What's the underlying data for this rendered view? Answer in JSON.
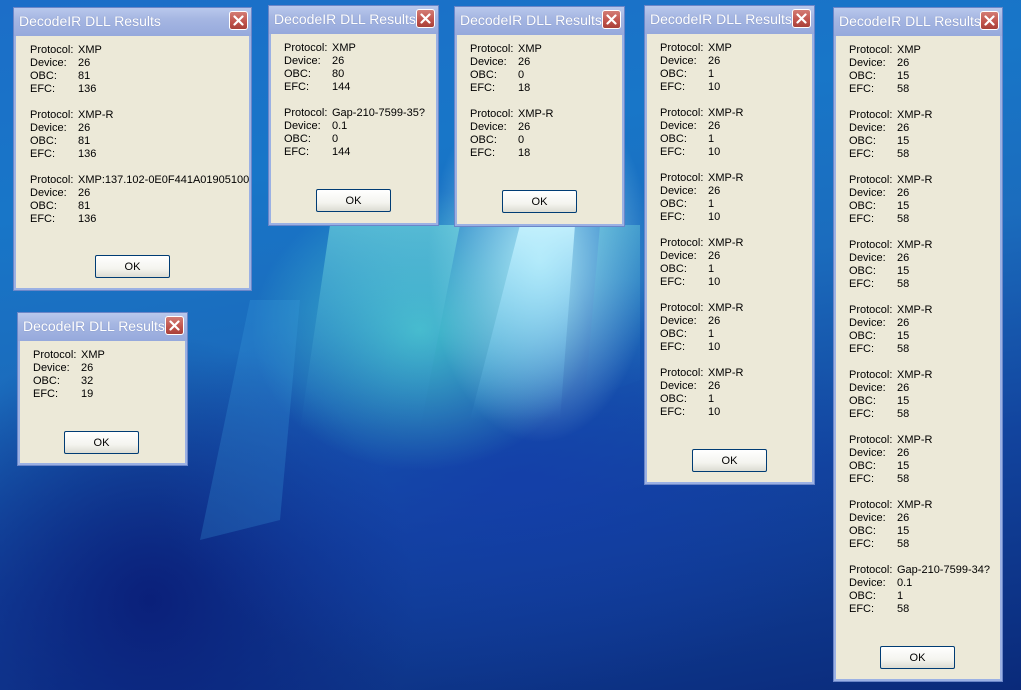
{
  "desktop": {
    "background": "blue-aurora-wallpaper"
  },
  "colors": {
    "dialog_face": "#ece9d8",
    "title_bar": "#a5b6e2",
    "close_button": "#c0524b"
  },
  "labels": {
    "protocol": "Protocol:",
    "device": "Device:",
    "obc": "OBC:",
    "efc": "EFC:"
  },
  "windows": [
    {
      "title": "DecodeIR DLL Results",
      "ok_label": "OK",
      "close_icon": "close-icon",
      "results": [
        {
          "protocol": "XMP",
          "device": "26",
          "obc": "81",
          "efc": "136"
        },
        {
          "protocol": "XMP-R",
          "device": "26",
          "obc": "81",
          "efc": "136"
        },
        {
          "protocol": "XMP:137.102-0E0F441A01905100",
          "device": "26",
          "obc": "81",
          "efc": "136"
        }
      ]
    },
    {
      "title": "DecodeIR DLL Results",
      "ok_label": "OK",
      "close_icon": "close-icon",
      "results": [
        {
          "protocol": "XMP",
          "device": "26",
          "obc": "80",
          "efc": "144"
        },
        {
          "protocol": "Gap-210-7599-35?",
          "device": "0.1",
          "obc": "0",
          "efc": "144"
        }
      ]
    },
    {
      "title": "DecodeIR DLL Results",
      "ok_label": "OK",
      "close_icon": "close-icon",
      "results": [
        {
          "protocol": "XMP",
          "device": "26",
          "obc": "0",
          "efc": "18"
        },
        {
          "protocol": "XMP-R",
          "device": "26",
          "obc": "0",
          "efc": "18"
        }
      ]
    },
    {
      "title": "DecodeIR DLL Results",
      "ok_label": "OK",
      "close_icon": "close-icon",
      "results": [
        {
          "protocol": "XMP",
          "device": "26",
          "obc": "1",
          "efc": "10"
        },
        {
          "protocol": "XMP-R",
          "device": "26",
          "obc": "1",
          "efc": "10"
        },
        {
          "protocol": "XMP-R",
          "device": "26",
          "obc": "1",
          "efc": "10"
        },
        {
          "protocol": "XMP-R",
          "device": "26",
          "obc": "1",
          "efc": "10"
        },
        {
          "protocol": "XMP-R",
          "device": "26",
          "obc": "1",
          "efc": "10"
        },
        {
          "protocol": "XMP-R",
          "device": "26",
          "obc": "1",
          "efc": "10"
        }
      ]
    },
    {
      "title": "DecodeIR DLL Results",
      "ok_label": "OK",
      "close_icon": "close-icon",
      "results": [
        {
          "protocol": "XMP",
          "device": "26",
          "obc": "15",
          "efc": "58"
        },
        {
          "protocol": "XMP-R",
          "device": "26",
          "obc": "15",
          "efc": "58"
        },
        {
          "protocol": "XMP-R",
          "device": "26",
          "obc": "15",
          "efc": "58"
        },
        {
          "protocol": "XMP-R",
          "device": "26",
          "obc": "15",
          "efc": "58"
        },
        {
          "protocol": "XMP-R",
          "device": "26",
          "obc": "15",
          "efc": "58"
        },
        {
          "protocol": "XMP-R",
          "device": "26",
          "obc": "15",
          "efc": "58"
        },
        {
          "protocol": "XMP-R",
          "device": "26",
          "obc": "15",
          "efc": "58"
        },
        {
          "protocol": "XMP-R",
          "device": "26",
          "obc": "15",
          "efc": "58"
        },
        {
          "protocol": "Gap-210-7599-34?",
          "device": "0.1",
          "obc": "1",
          "efc": "58"
        }
      ]
    },
    {
      "title": "DecodeIR DLL Results",
      "ok_label": "OK",
      "close_icon": "close-icon",
      "results": [
        {
          "protocol": "XMP",
          "device": "26",
          "obc": "32",
          "efc": "19"
        }
      ]
    }
  ]
}
